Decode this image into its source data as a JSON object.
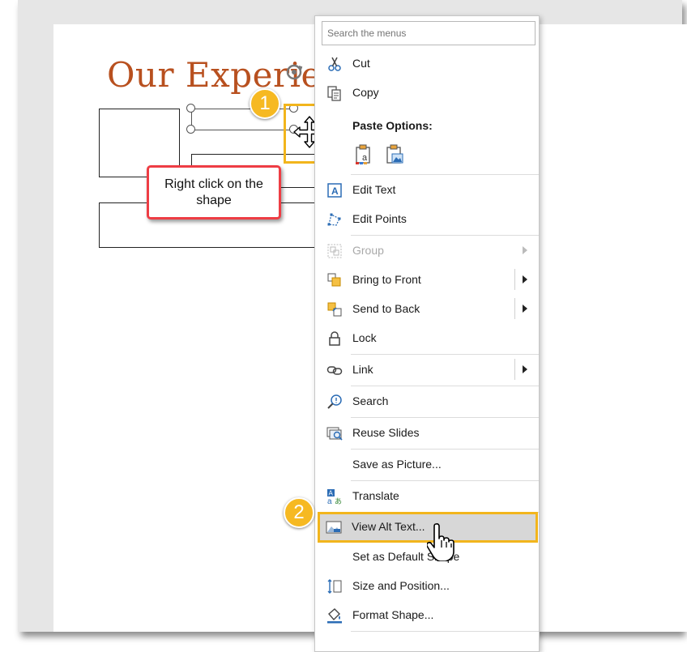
{
  "slide": {
    "title": "Our Experie",
    "callout_text": "Right click on the shape"
  },
  "badges": {
    "step1": "1",
    "step2": "2"
  },
  "menu": {
    "search_placeholder": "Search the menus",
    "paste_options_label": "Paste Options:",
    "items": {
      "cut": "Cut",
      "copy": "Copy",
      "edit_text": "Edit Text",
      "edit_points": "Edit Points",
      "group": "Group",
      "bring_to_front": "Bring to Front",
      "send_to_back": "Send to Back",
      "lock": "Lock",
      "link": "Link",
      "search": "Search",
      "reuse_slides": "Reuse Slides",
      "save_as_picture": "Save as Picture...",
      "translate": "Translate",
      "view_alt_text": "View Alt Text...",
      "set_default_shape": "Set as Default Shape",
      "size_and_position": "Size and Position...",
      "format_shape": "Format Shape..."
    }
  },
  "colors": {
    "title": "#b8501f",
    "badge": "#f6b922",
    "highlight": "#f2b51c",
    "callout_border": "#ee3d44",
    "icon_blue": "#2b6cb5"
  }
}
